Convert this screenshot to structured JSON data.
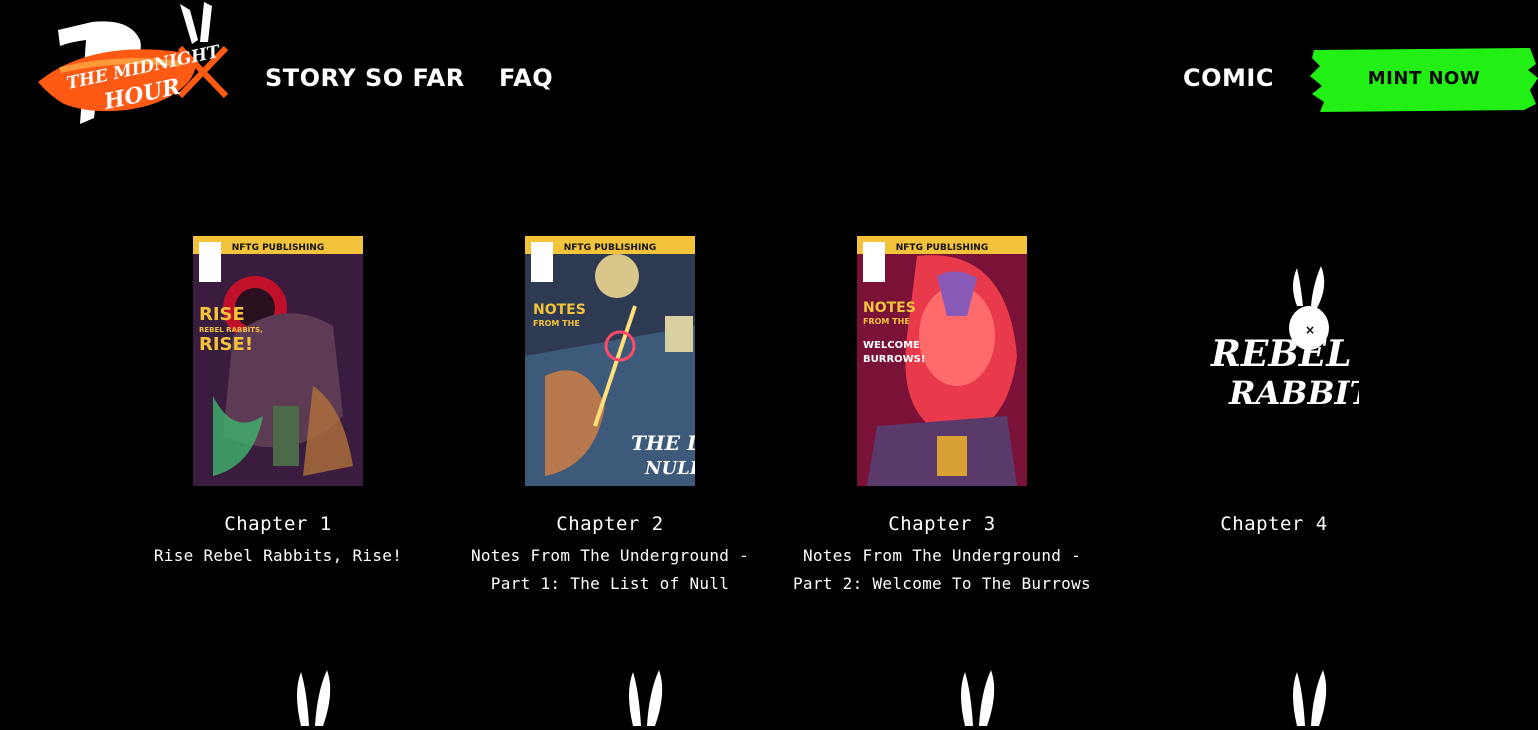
{
  "header": {
    "logo_alt": "The Midnight Hour",
    "nav_left": [
      "STORY SO FAR",
      "FAQ"
    ],
    "nav_right": [
      "COMIC"
    ],
    "cta_label": "MINT NOW",
    "cta_color": "#22f014"
  },
  "chapters": [
    {
      "chapter": "Chapter 1",
      "title": "Rise Rebel Rabbits, Rise!",
      "cover": "comic-cover-1"
    },
    {
      "chapter": "Chapter 2",
      "title": "Notes From The Underground - Part 1: The List of Null",
      "cover": "comic-cover-2"
    },
    {
      "chapter": "Chapter 3",
      "title": "Notes From The Underground - Part 2: Welcome To The Burrows",
      "cover": "comic-cover-3"
    },
    {
      "chapter": "Chapter 4",
      "title": "",
      "cover": "rebel-rabbits-logo"
    }
  ],
  "brand_logo_text": "Rebel Rabbits",
  "cover_publisher": "NFTG PUBLISHING",
  "colors": {
    "background": "#000000",
    "text": "#ffffff",
    "accent_orange": "#ff5a14"
  }
}
